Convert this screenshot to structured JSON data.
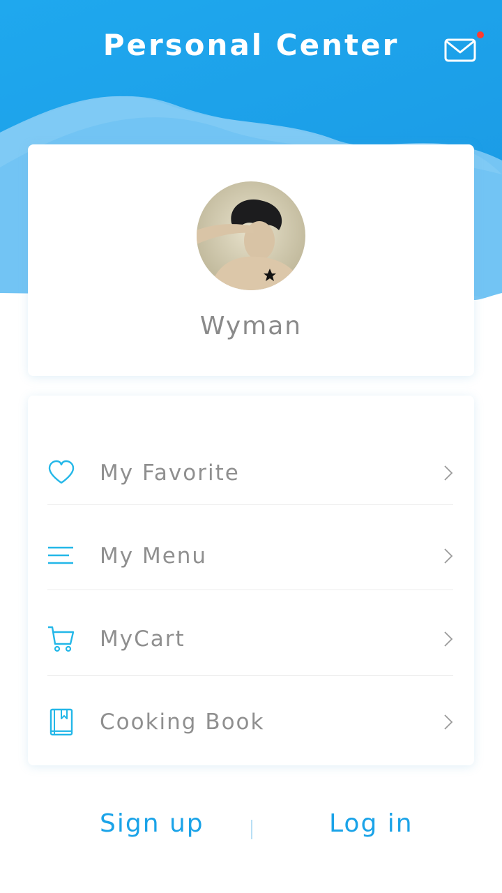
{
  "header": {
    "title": "Personal Center",
    "mail_icon": "mail-icon",
    "accent": "#1da1ec"
  },
  "profile": {
    "username": "Wyman",
    "avatar_icon": "user-avatar"
  },
  "menu": {
    "items": [
      {
        "label": "My Favorite",
        "icon": "heart-icon"
      },
      {
        "label": "My Menu",
        "icon": "menu-lines-icon"
      },
      {
        "label": "MyCart",
        "icon": "cart-icon"
      },
      {
        "label": "Cooking Book",
        "icon": "book-icon"
      }
    ]
  },
  "auth": {
    "signup_label": "Sign up",
    "login_label": "Log in"
  }
}
